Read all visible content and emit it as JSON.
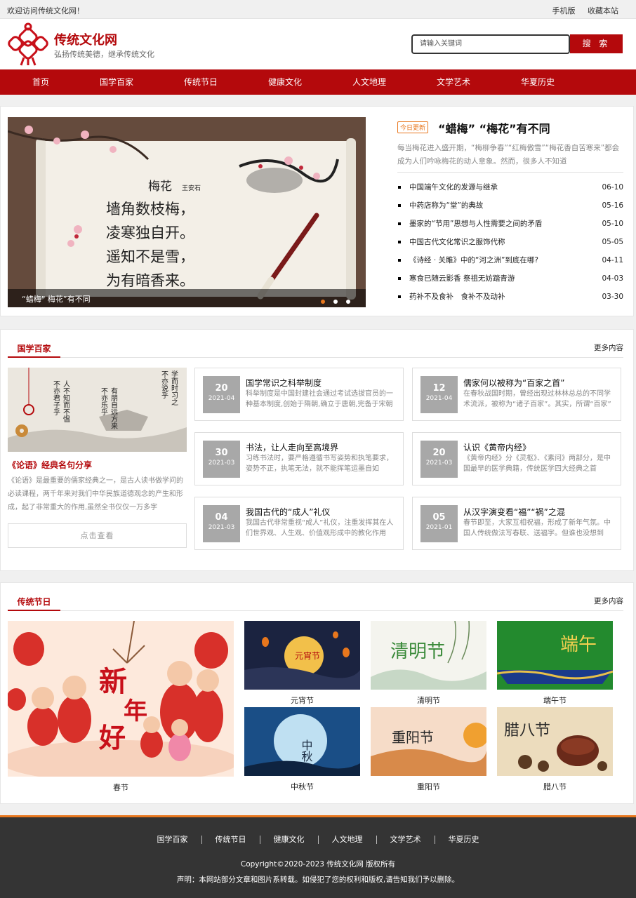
{
  "topbar": {
    "welcome": "欢迎访问传统文化网！",
    "mobile": "手机版",
    "bookmark": "收藏本站"
  },
  "header": {
    "site_name": "传统文化网",
    "slogan": "弘扬传统美德，继承传统文化",
    "search_placeholder": "请输入关键词",
    "search_button": "搜 索"
  },
  "nav": [
    "首页",
    "国学百家",
    "传统节日",
    "健康文化",
    "人文地理",
    "文学艺术",
    "华夏历史"
  ],
  "hero": {
    "slide_caption": "“蜡梅” 梅花”有不同",
    "slide_poem": [
      "梅花",
      "王安石",
      "墙角数枝梅，",
      "凌寒独自开。",
      "遥知不是雪，",
      "为有暗香来。"
    ],
    "badge": "今日更新",
    "headline": "“蜡梅” “梅花”有不同",
    "summary": "每当梅花进入盛开期，“梅柳争春”“红梅傲雪”“梅花香自苦寒来”都会成为人们吟咏梅花的动人意象。然而，很多人不知道",
    "news": [
      {
        "title": "中国端午文化的发源与继承",
        "date": "06-10"
      },
      {
        "title": "中药店称为“堂”的典故",
        "date": "05-16"
      },
      {
        "title": "墨家的“节用”思想与人性需要之间的矛盾",
        "date": "05-10"
      },
      {
        "title": "中国古代文化常识之服饰代称",
        "date": "05-05"
      },
      {
        "title": "《诗经 · 关雎》中的“河之洲”到底在哪?",
        "date": "04-11"
      },
      {
        "title": "寒食已随云影香 祭祖无妨踏青游",
        "date": "04-03"
      },
      {
        "title": "药补不及食补　食补不及动补",
        "date": "03-30"
      }
    ]
  },
  "guoxue": {
    "title": "国学百家",
    "more": "更多内容",
    "img_text": [
      "学而时习之",
      "不亦说乎",
      "有朋自远方来",
      "不亦乐乎",
      "人不知而不愠",
      "不亦君子乎"
    ],
    "feature": {
      "title": "《论语》经典名句分享",
      "text": "《论语》是最重要的儒家经典之一，是古人读书做学问的必读课程，两千年来对我们中华民族道德观念的产生和形成，起了非常重大的作用,虽然全书仅仅一万多字",
      "button": "点击查看"
    },
    "cards": [
      {
        "day": "20",
        "ym": "2021-04",
        "title": "国学常识之科举制度",
        "desc": "科举制度是中国封建社会通过考试选拔官员的一种基本制度,创始于隋朝,确立于唐朝,完备于宋朝"
      },
      {
        "day": "12",
        "ym": "2021-04",
        "title": "儒家何以被称为“百家之首”",
        "desc": "在春秋战国时期，曾经出现过林林总总的不同学术流派，被称为“诸子百家”。其实，所谓“百家”"
      },
      {
        "day": "30",
        "ym": "2021-03",
        "title": "书法，让人走向至高境界",
        "desc": "习练书法时，要严格遵循书写姿势和执笔要求，姿势不正，执笔无法，就不能挥笔运墨自如"
      },
      {
        "day": "20",
        "ym": "2021-03",
        "title": "认识《黄帝内经》",
        "desc": "《黄帝内经》分《灵枢》、《素问》两部分，是中国最早的医学典籍，传统医学四大经典之首"
      },
      {
        "day": "04",
        "ym": "2021-03",
        "title": "我国古代的“成人”礼仪",
        "desc": "我国古代非常重视“成人”礼仪，注重发挥其在人们世界观、人生观、价值观形成中的教化作用"
      },
      {
        "day": "05",
        "ym": "2021-01",
        "title": "从汉字演变看“福”“祸”之混",
        "desc": "春节即至，大家互相祝福，形成了新年气氛。中国人传统做法写春联、送福字。但谁也没想到"
      }
    ]
  },
  "festivals": {
    "title": "传统节日",
    "more": "更多内容",
    "big": {
      "label": "春节",
      "art_text": [
        "新",
        "年",
        "好"
      ]
    },
    "items": [
      {
        "label": "元宵节",
        "art": "元宵节"
      },
      {
        "label": "清明节",
        "art": "清明节"
      },
      {
        "label": "端午节",
        "art": "端午"
      },
      {
        "label": "中秋节",
        "art": "中秋"
      },
      {
        "label": "重阳节",
        "art": "重阳节"
      },
      {
        "label": "腊八节",
        "art": "腊八节"
      }
    ]
  },
  "footer": {
    "links": [
      "国学百家",
      "传统节日",
      "健康文化",
      "人文地理",
      "文学艺术",
      "华夏历史"
    ],
    "copyright": "Copyright©2020-2023 传统文化网 版权所有",
    "statement": "声明：本网站部分文章和图片系转载。如侵犯了您的权利和版权,请告知我们予以删除。"
  },
  "colors": {
    "brand_red": "#b4090c",
    "accent_orange": "#e8771d",
    "footer_bg": "#343434"
  }
}
